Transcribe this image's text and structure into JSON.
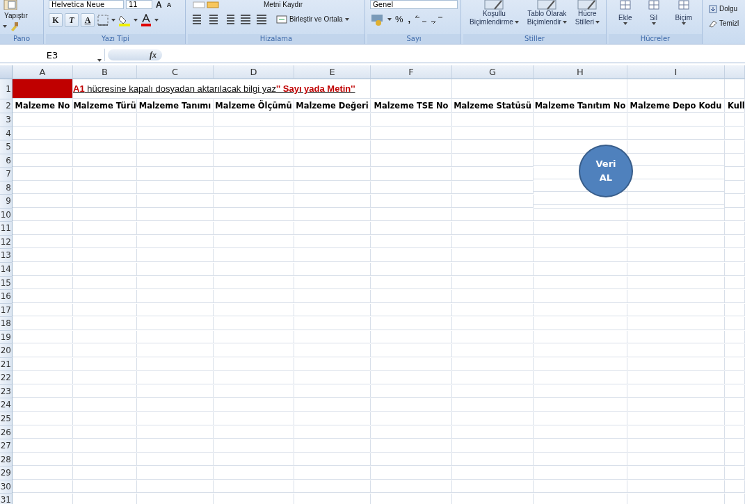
{
  "ribbon": {
    "pano": {
      "label": "Pano",
      "paste": "Yapıştır"
    },
    "font": {
      "label": "Yazı Tipi",
      "font_name": "Helvetica Neue",
      "font_size": "11",
      "grow": "A",
      "shrink": "A",
      "style_buttons": [
        "K",
        "T",
        "A"
      ]
    },
    "alignment": {
      "label": "Hizalama",
      "wrap": "Metni Kaydır",
      "merge": "Birleştir ve Ortala"
    },
    "number": {
      "label": "Sayı",
      "format": "Genel",
      "percent": "%",
      "comma": ","
    },
    "styles": {
      "label": "Stiller",
      "buttons": [
        {
          "line1": "Koşullu",
          "line2": "Biçimlendirme"
        },
        {
          "line1": "Tablo Olarak",
          "line2": "Biçimlendir"
        },
        {
          "line1": "Hücre",
          "line2": "Stilleri"
        }
      ]
    },
    "cells": {
      "label": "Hücreler",
      "buttons": [
        "Ekle",
        "Sil",
        "Biçim"
      ]
    },
    "editing": {
      "buttons": [
        "Dolgu",
        "Temizl"
      ]
    }
  },
  "formula_bar": {
    "name_box": "E3",
    "fx": "fx"
  },
  "sheet": {
    "columns": [
      "A",
      "B",
      "C",
      "D",
      "E",
      "F",
      "G",
      "H",
      "I",
      ""
    ],
    "note": [
      {
        "text": "A1",
        "kind": "emphasis"
      },
      {
        "text": " hücresine kapalı dosyadan aktarılacak bilgi yaz",
        "kind": "plain"
      },
      {
        "text": "'' Sayı yada Metin''",
        "kind": "emphasis"
      }
    ],
    "headers": [
      "Malzeme No",
      "Malzeme Türü",
      "Malzeme Tanımı",
      "Malzeme Ölçümü",
      "Malzeme Değeri",
      "Malzeme TSE No",
      "Malzeme Statüsü",
      "Malzeme Tanıtım No",
      "Malzeme Depo Kodu",
      "Kull"
    ],
    "row_numbers": [
      "1",
      "2",
      "3",
      "4",
      "5",
      "6",
      "7",
      "8",
      "9",
      "10",
      "11",
      "12",
      "13",
      "14",
      "15",
      "16",
      "17",
      "18",
      "19",
      "20",
      "21",
      "22",
      "23",
      "24",
      "25",
      "26",
      "27",
      "28",
      "29",
      "30",
      "31"
    ],
    "button": {
      "line1": "Veri",
      "line2": "AL"
    }
  }
}
